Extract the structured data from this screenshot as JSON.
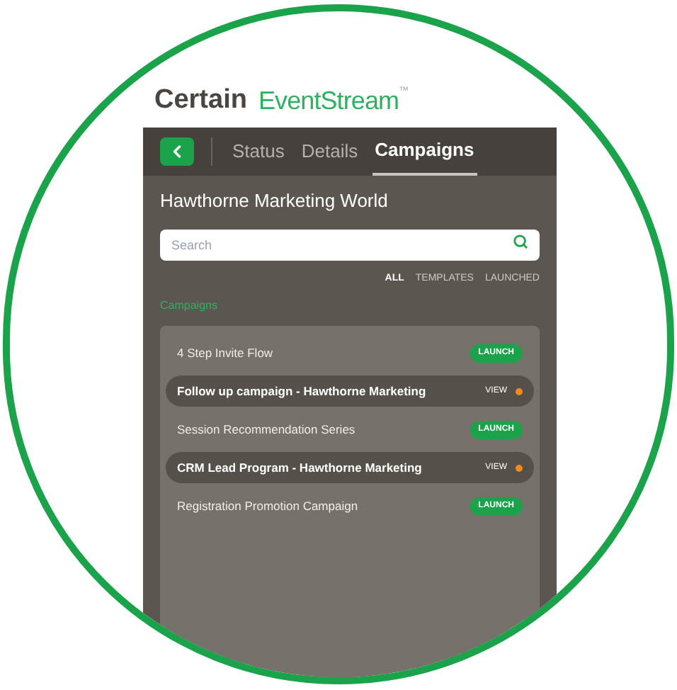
{
  "logo": {
    "brand": "Certain",
    "product": "EventStream",
    "trademark": "™"
  },
  "tabs": [
    {
      "label": "Status",
      "selected": false
    },
    {
      "label": "Details",
      "selected": false
    },
    {
      "label": "Campaigns",
      "selected": true
    }
  ],
  "event_title": "Hawthorne Marketing World",
  "search": {
    "placeholder": "Search"
  },
  "filters": [
    {
      "label": "ALL",
      "selected": true
    },
    {
      "label": "TEMPLATES",
      "selected": false
    },
    {
      "label": "LAUNCHED",
      "selected": false
    }
  ],
  "section_title": "Campaigns",
  "campaigns": [
    {
      "name": "4 Step Invite Flow",
      "kind": "launch",
      "action": "LAUNCH"
    },
    {
      "name": "Follow up campaign - Hawthorne Marketing",
      "kind": "view",
      "action": "VIEW"
    },
    {
      "name": "Session Recommendation Series",
      "kind": "launch",
      "action": "LAUNCH"
    },
    {
      "name": "CRM Lead Program - Hawthorne Marketing",
      "kind": "view",
      "action": "VIEW"
    },
    {
      "name": "Registration Promotion Campaign",
      "kind": "launch",
      "action": "LAUNCH"
    }
  ]
}
